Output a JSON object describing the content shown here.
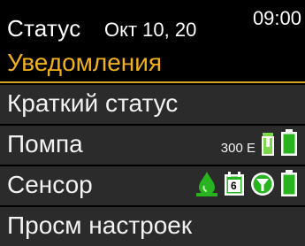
{
  "header": {
    "title": "Статус",
    "date": "Окт 10, 20",
    "time": "09:00"
  },
  "menu": {
    "items": [
      {
        "label": "Уведомления",
        "selected": true
      },
      {
        "label": "Краткий статус"
      },
      {
        "label": "Помпа",
        "pump_volume": "300 E"
      },
      {
        "label": "Сенсор",
        "sensor_day": "6"
      },
      {
        "label": "Просм настроек"
      }
    ]
  },
  "colors": {
    "accent": "#F0B11A",
    "row_bg": "#2B2B2B",
    "battery_green": "#27B41E",
    "reservoir_green": "#7CD64A"
  }
}
